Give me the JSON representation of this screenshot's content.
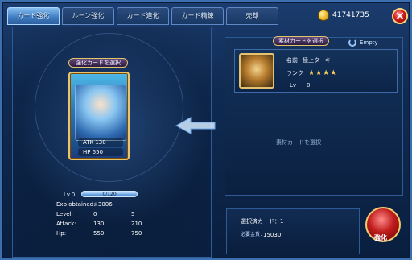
{
  "tabs": [
    {
      "label": "カード強化"
    },
    {
      "label": "ルーン強化"
    },
    {
      "label": "カード進化"
    },
    {
      "label": "カード精錬"
    },
    {
      "label": "売却"
    }
  ],
  "header": {
    "gold_amount": "41741735"
  },
  "left": {
    "enhance_card_label": "強化カードを選択",
    "card_atk": "130",
    "card_hp": "550",
    "level_label": "Lv.0",
    "exp_bar_text": "0/120",
    "stats": [
      {
        "name": "Exp obtained:",
        "before": "+3006",
        "after": ""
      },
      {
        "name": "Level:",
        "before": "0",
        "after": "5"
      },
      {
        "name": "Attack:",
        "before": "130",
        "after": "210"
      },
      {
        "name": "Hp:",
        "before": "550",
        "after": "750"
      }
    ]
  },
  "right": {
    "material_label": "素材カードを選択",
    "empty_label": "Empty",
    "material": {
      "name_key": "名前",
      "name_value": "極上ターキー",
      "rank_key": "ランク",
      "rank_stars": "★★★★",
      "level_key": "Lv",
      "level_value": "0"
    },
    "select_hint": "素材カードを選択"
  },
  "bottom": {
    "selected_count_text": "選択済カード：1",
    "cost_key": "必要金貨：",
    "cost_value": "15030",
    "enhance_button_label": "強化"
  },
  "colors": {
    "frame_blue": "#3b6fb0",
    "accent_gold": "#f0cf73",
    "enhance_red": "#c01d1d"
  }
}
